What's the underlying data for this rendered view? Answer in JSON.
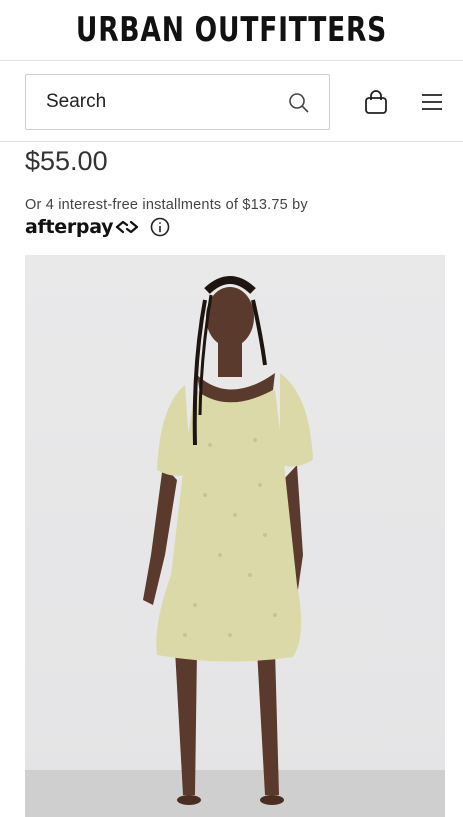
{
  "header": {
    "brand": "URBAN OUTFITTERS"
  },
  "search": {
    "placeholder": "Search",
    "icon": "search-icon"
  },
  "nav_icons": {
    "bag": "bag-icon",
    "menu": "hamburger-menu-icon"
  },
  "product": {
    "price": "$55.00",
    "installments_text": "Or 4 interest-free installments of $13.75 by",
    "afterpay_label": "afterpay",
    "info_icon": "info-icon",
    "image": {
      "subject": "model wearing light yellow floral mini dress with puff sleeves",
      "dress_color": "#dcd9a8",
      "background_color": "#e7e7e9"
    }
  },
  "colors": {
    "text_primary": "#111111",
    "text_secondary": "#444444",
    "divider": "#e2e2e2"
  }
}
